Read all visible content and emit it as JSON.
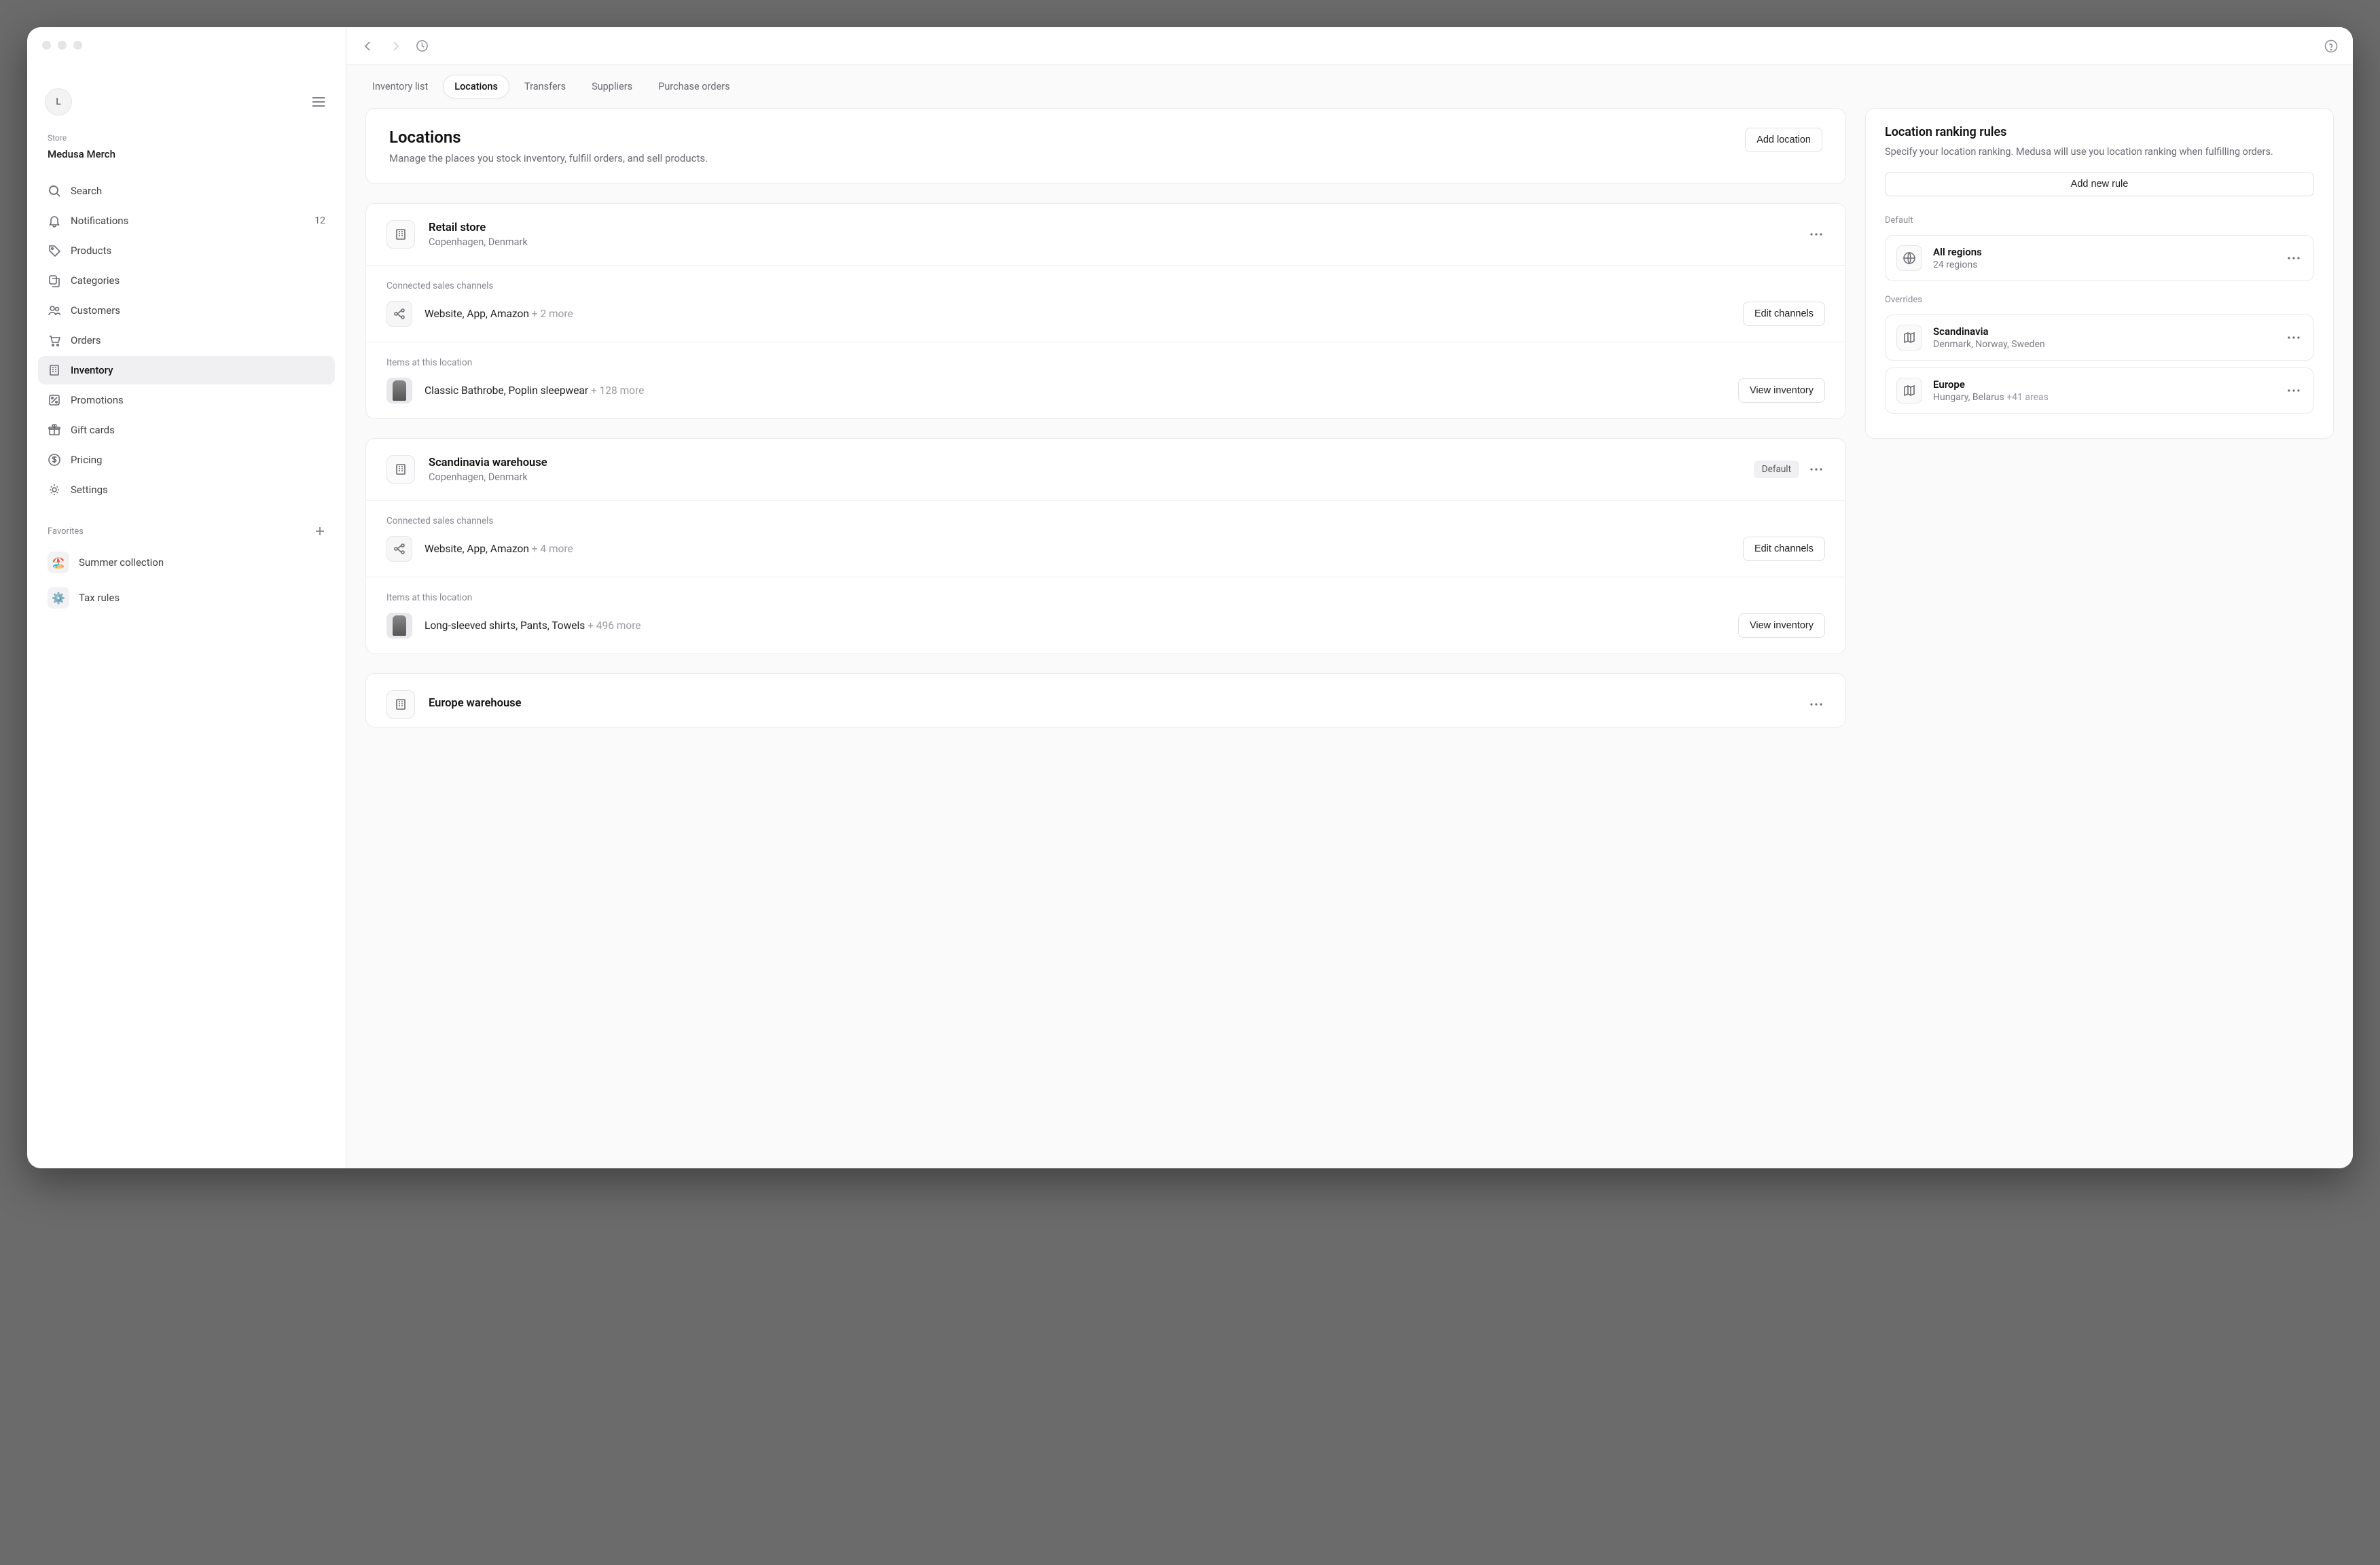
{
  "sidebar": {
    "avatar_letter": "L",
    "store_label": "Store",
    "store_name": "Medusa Merch",
    "nav": [
      {
        "label": "Search",
        "icon": "search"
      },
      {
        "label": "Notifications",
        "icon": "bell",
        "badge": "12"
      },
      {
        "label": "Products",
        "icon": "tag"
      },
      {
        "label": "Categories",
        "icon": "layers"
      },
      {
        "label": "Customers",
        "icon": "users"
      },
      {
        "label": "Orders",
        "icon": "cart"
      },
      {
        "label": "Inventory",
        "icon": "building",
        "active": true
      },
      {
        "label": "Promotions",
        "icon": "percent"
      },
      {
        "label": "Gift cards",
        "icon": "gift"
      },
      {
        "label": "Pricing",
        "icon": "dollar"
      },
      {
        "label": "Settings",
        "icon": "gear"
      }
    ],
    "favorites_label": "Favorites",
    "favorites": [
      {
        "label": "Summer collection",
        "emoji": "🏖️"
      },
      {
        "label": "Tax rules",
        "emoji": "⚙️"
      }
    ]
  },
  "tabs": [
    {
      "label": "Inventory list"
    },
    {
      "label": "Locations",
      "active": true
    },
    {
      "label": "Transfers"
    },
    {
      "label": "Suppliers"
    },
    {
      "label": "Purchase orders"
    }
  ],
  "header": {
    "title": "Locations",
    "subtitle": "Manage the places you stock inventory, fulfill orders, and sell products.",
    "add_button": "Add location"
  },
  "locations": [
    {
      "name": "Retail store",
      "address": "Copenhagen, Denmark",
      "default": false,
      "channels_label": "Connected sales channels",
      "channels_text": "Website, App, Amazon",
      "channels_more": "+ 2 more",
      "edit_channels": "Edit channels",
      "items_label": "Items at this location",
      "items_text": "Classic Bathrobe, Poplin sleepwear",
      "items_more": "+ 128 more",
      "view_inventory": "View inventory"
    },
    {
      "name": "Scandinavia warehouse",
      "address": "Copenhagen, Denmark",
      "default": true,
      "default_label": "Default",
      "channels_label": "Connected sales channels",
      "channels_text": "Website, App, Amazon",
      "channels_more": "+ 4 more",
      "edit_channels": "Edit channels",
      "items_label": "Items at this location",
      "items_text": "Long-sleeved shirts, Pants, Towels",
      "items_more": "+ 496 more",
      "view_inventory": "View inventory"
    },
    {
      "name": "Europe warehouse",
      "address": "",
      "default": false
    }
  ],
  "rules": {
    "title": "Location ranking rules",
    "subtitle": "Specify your location ranking. Medusa will use you location ranking when fulfilling orders.",
    "add_button": "Add new rule",
    "default_label": "Default",
    "default_rule": {
      "title": "All regions",
      "sub": "24 regions"
    },
    "overrides_label": "Overrides",
    "overrides": [
      {
        "title": "Scandinavia",
        "sub": "Denmark, Norway, Sweden"
      },
      {
        "title": "Europe",
        "sub": "Hungary, Belarus",
        "sub_more": "+41 areas"
      }
    ]
  }
}
